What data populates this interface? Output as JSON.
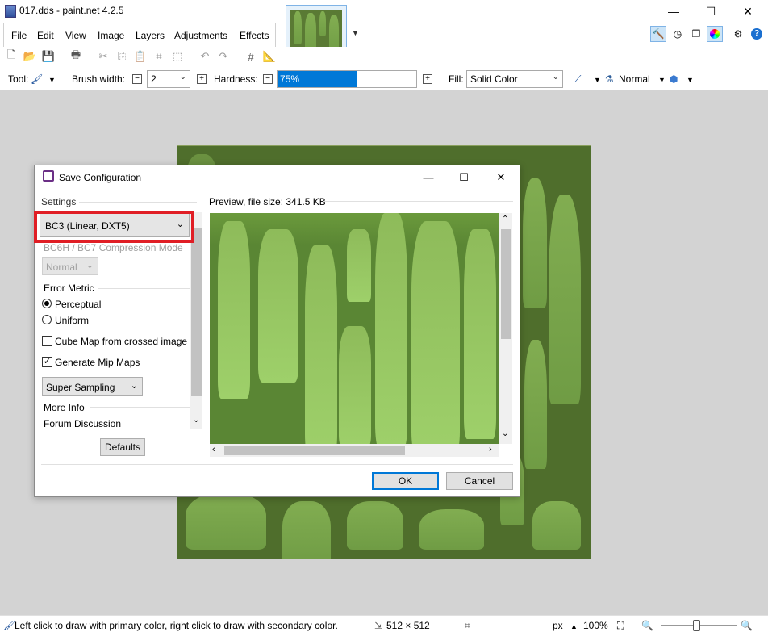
{
  "window": {
    "title": "017.dds - paint.net 4.2.5",
    "controls": {
      "minimize": "—",
      "maximize": "☐",
      "close": "✕"
    }
  },
  "menu": [
    "File",
    "Edit",
    "View",
    "Image",
    "Layers",
    "Adjustments",
    "Effects"
  ],
  "toolbar": {
    "tool_label": "Tool:",
    "brush_width_label": "Brush width:",
    "brush_width_value": "2",
    "hardness_label": "Hardness:",
    "hardness_value": "75%",
    "hardness_fraction": 0.75,
    "fill_label": "Fill:",
    "fill_value": "Solid Color",
    "blend_mode": "Normal"
  },
  "dialog": {
    "title": "Save Configuration",
    "settings_label": "Settings",
    "format_value": "BC3 (Linear, DXT5)",
    "compression_mode_label": "BC6H / BC7 Compression Mode",
    "compression_mode_value": "Normal",
    "error_metric_label": "Error Metric",
    "perceptual_label": "Perceptual",
    "uniform_label": "Uniform",
    "cube_map_label": "Cube Map from crossed image",
    "mip_maps_label": "Generate Mip Maps",
    "sampling_value": "Super Sampling",
    "more_info_label": "More Info",
    "forum_label": "Forum Discussion",
    "defaults_label": "Defaults",
    "preview_label": "Preview, file size: 341.5 KB",
    "ok_label": "OK",
    "cancel_label": "Cancel",
    "selected_error_metric": "Perceptual",
    "cube_map_checked": false,
    "mip_maps_checked": true
  },
  "status": {
    "hint": "Left click to draw with primary color, right click to draw with secondary color.",
    "image_size": "512 × 512",
    "units": "px",
    "zoom": "100%"
  },
  "colors": {
    "highlight": "#e01e25",
    "accent": "#0078d7",
    "texture_dark": "#4f6e2c",
    "texture_light": "#8ebb5a"
  }
}
